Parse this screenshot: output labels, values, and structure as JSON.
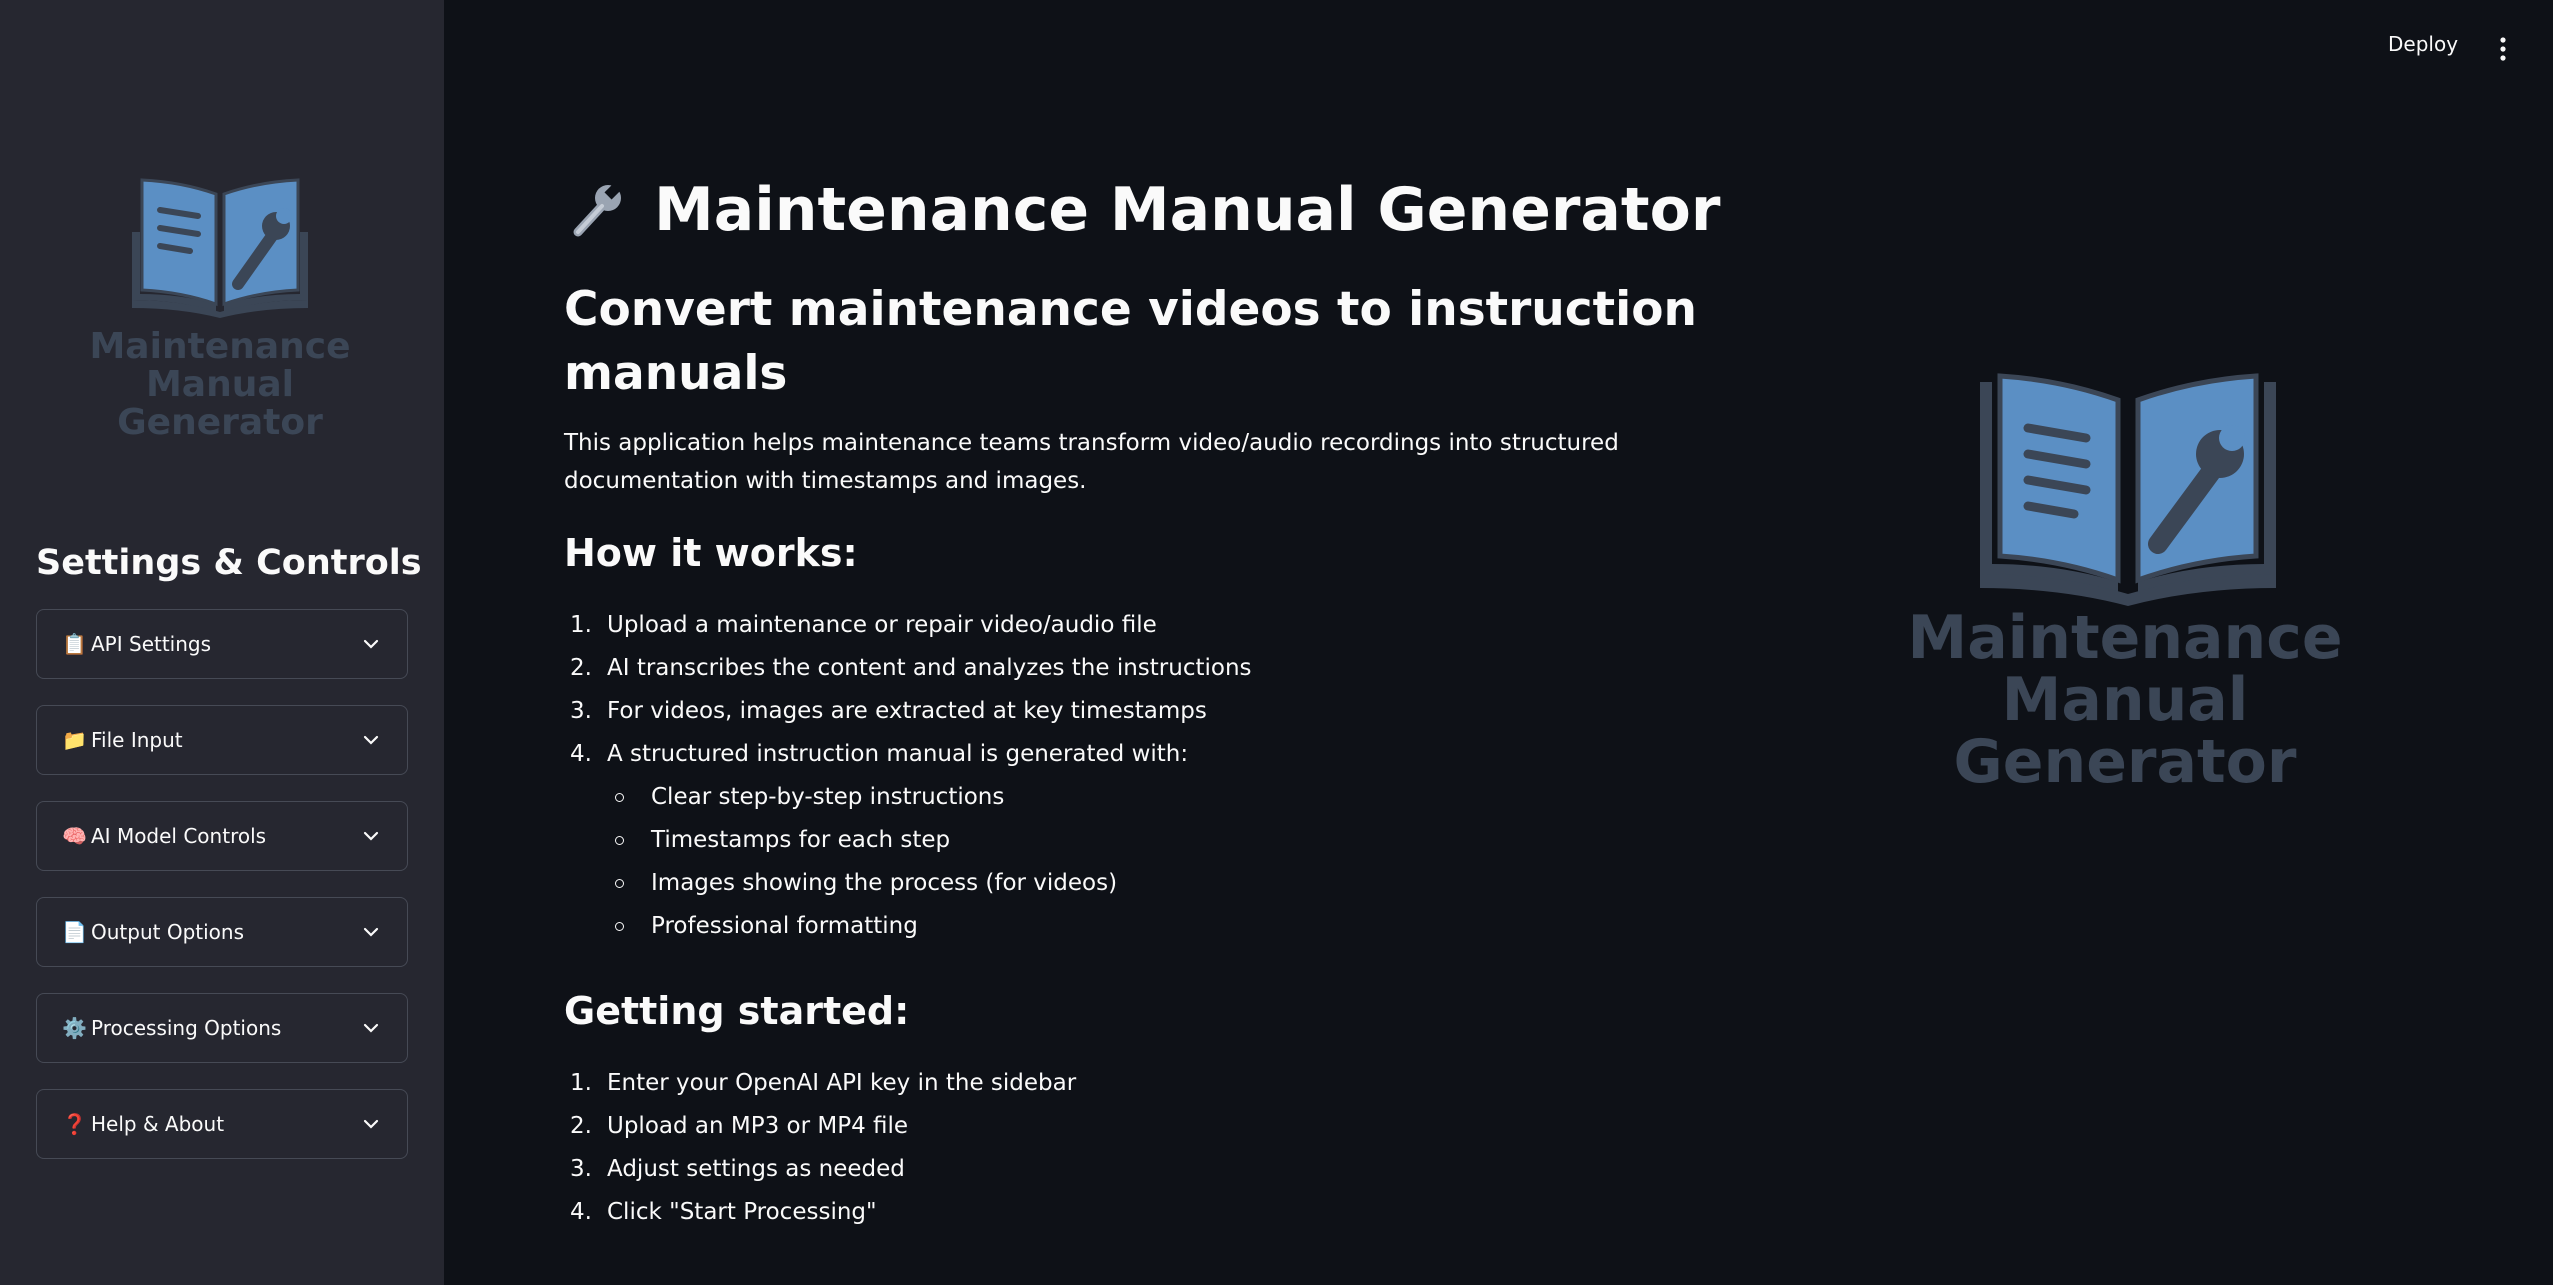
{
  "topbar": {
    "deploy_label": "Deploy",
    "menu_icon": "kebab-menu-icon"
  },
  "sidebar": {
    "logo_text": [
      "Maintenance",
      "Manual",
      "Generator"
    ],
    "title": "Settings & Controls",
    "expanders": [
      {
        "icon": "📋",
        "label": "API Settings"
      },
      {
        "icon": "📁",
        "label": "File Input"
      },
      {
        "icon": "🧠",
        "label": "AI Model Controls"
      },
      {
        "icon": "📄",
        "label": "Output Options"
      },
      {
        "icon": "⚙️",
        "label": "Processing Options"
      },
      {
        "icon": "❓",
        "label": "Help & About"
      }
    ]
  },
  "main": {
    "title": "Maintenance Manual Generator",
    "subtitle": "Convert maintenance videos to instruction manuals",
    "intro": "This application helps maintenance teams transform video/audio recordings into structured documentation with timestamps and images.",
    "how_heading": "How it works:",
    "how_steps": [
      "Upload a maintenance or repair video/audio file",
      "AI transcribes the content and analyzes the instructions",
      "For videos, images are extracted at key timestamps",
      "A structured instruction manual is generated with:"
    ],
    "how_substeps": [
      "Clear step-by-step instructions",
      "Timestamps for each step",
      "Images showing the process (for videos)",
      "Professional formatting"
    ],
    "start_heading": "Getting started:",
    "start_steps": [
      "Enter your OpenAI API key in the sidebar",
      "Upload an MP3 or MP4 file",
      "Adjust settings as needed",
      "Click \"Start Processing\""
    ],
    "hero_logo_text": [
      "Maintenance",
      "Manual",
      "Generator"
    ]
  },
  "colors": {
    "background": "#0e1117",
    "sidebar": "#262730",
    "book_blue": "#5b8fc4",
    "book_dark": "#3b4656",
    "text": "#fafafa"
  }
}
